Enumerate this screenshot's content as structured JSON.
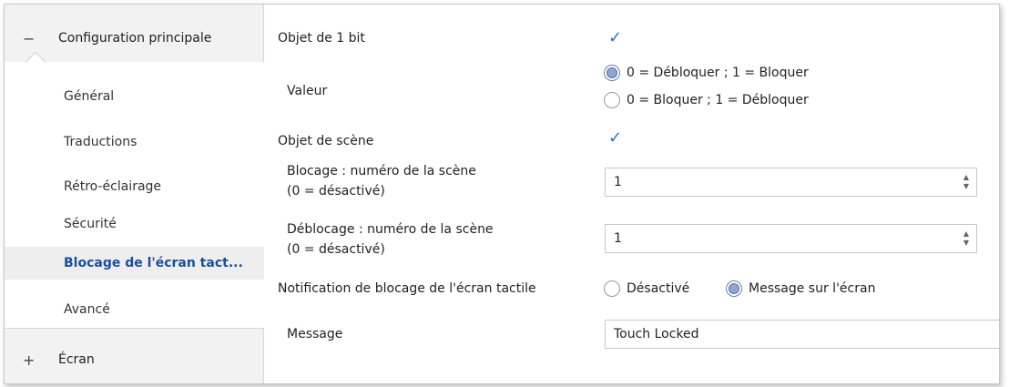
{
  "sidebar": {
    "main_group": {
      "toggle": "−",
      "label": "Configuration principale"
    },
    "items": [
      {
        "label": "Général"
      },
      {
        "label": "Traductions"
      },
      {
        "label": "Rétro-éclairage"
      },
      {
        "label": "Sécurité"
      },
      {
        "label": "Blocage de l'écran tact..."
      },
      {
        "label": "Avancé"
      }
    ],
    "screen_group": {
      "toggle": "+",
      "label": "Écran"
    }
  },
  "content": {
    "obj1bit": {
      "label": "Objet de 1 bit",
      "checked": true
    },
    "valeur": {
      "label": "Valeur",
      "options": [
        "0 = Débloquer ; 1 = Bloquer",
        "0 = Bloquer ; 1 = Débloquer"
      ],
      "selected": 0
    },
    "objscene": {
      "label": "Objet de scène",
      "checked": true
    },
    "blocage": {
      "label_line1": "Blocage : numéro de la scène",
      "label_line2": "(0 = désactivé)",
      "value": "1"
    },
    "deblocage": {
      "label_line1": "Déblocage : numéro de la scène",
      "label_line2": "(0 = désactivé)",
      "value": "1"
    },
    "notification": {
      "label": "Notification de blocage de l'écran tactile",
      "options": [
        "Désactivé",
        "Message sur l'écran"
      ],
      "selected": 1
    },
    "message": {
      "label": "Message",
      "value": "Touch Locked"
    }
  },
  "icons": {
    "check": "✓",
    "spin_up": "▲",
    "spin_down": "▼"
  },
  "colors": {
    "active_nav_text": "#1a4fa0",
    "check": "#2d6fc4"
  }
}
